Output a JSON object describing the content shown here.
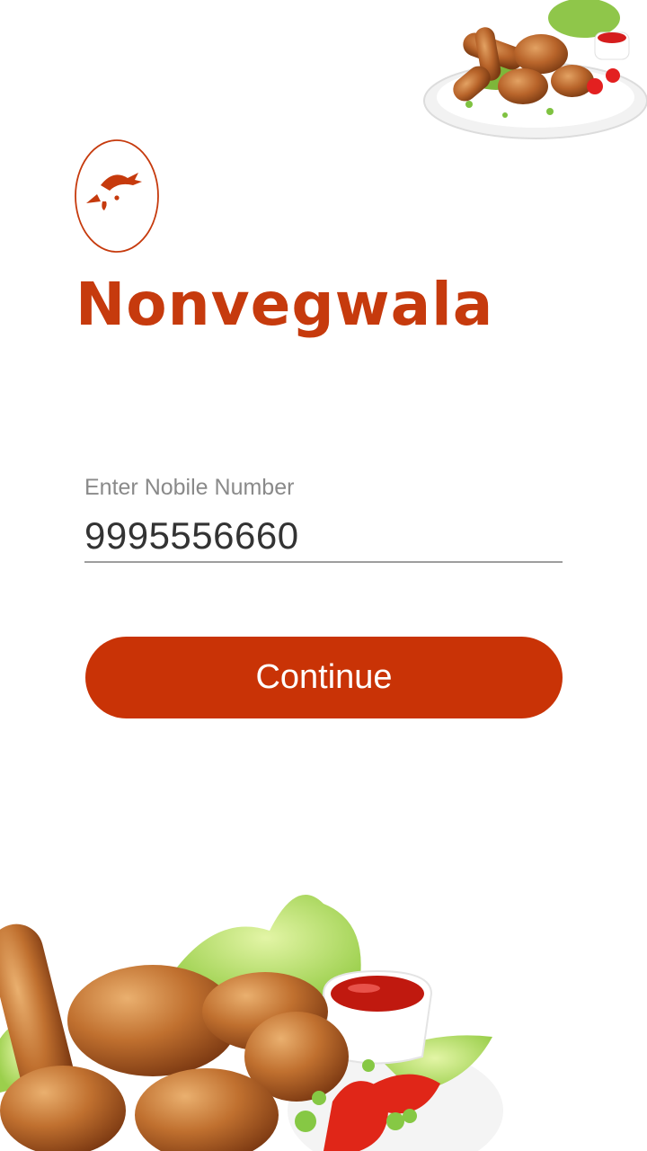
{
  "app": {
    "brand_name": "Nonvegwala"
  },
  "login": {
    "phone_label": "Enter Nobile Number",
    "phone_value": "9995556660",
    "continue_label": "Continue"
  },
  "colors": {
    "brand": "#c63a0d",
    "button": "#c93306",
    "label": "#8a8a8a",
    "input_text": "#333333"
  },
  "icons": {
    "logo": "egg-with-chicken-icon"
  }
}
